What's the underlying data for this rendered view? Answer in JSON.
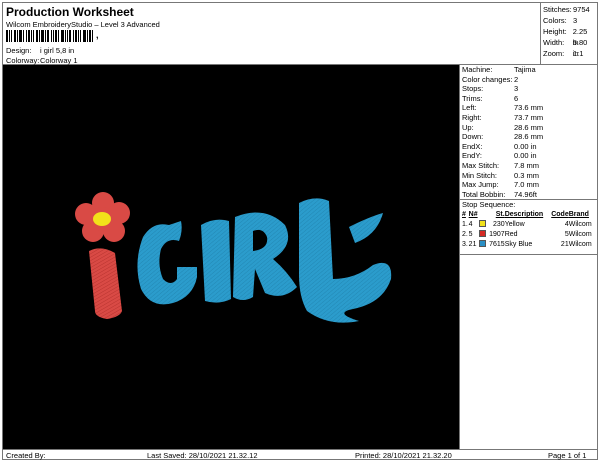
{
  "header": {
    "title": "Production Worksheet",
    "software": "Wilcom EmbroideryStudio – Level 3 Advanced",
    "barcode_suffix": ",",
    "design_label": "Design:",
    "design_value": "i girl 5,8 in",
    "colorway_label": "Colorway:",
    "colorway_value": "Colorway 1"
  },
  "summary": {
    "stitches_label": "Stitches:",
    "stitches_value": "9754",
    "colors_label": "Colors:",
    "colors_value": "3",
    "height_label": "Height:",
    "height_value": "2.25 in",
    "width_label": "Width:",
    "width_value": "5.80 in",
    "zoom_label": "Zoom:",
    "zoom_value": "1:1"
  },
  "stats": [
    {
      "label": "Machine:",
      "value": "Tajima"
    },
    {
      "label": "Color changes:",
      "value": "2"
    },
    {
      "label": "Stops:",
      "value": "3"
    },
    {
      "label": "Trims:",
      "value": "6"
    },
    {
      "label": "Left:",
      "value": "73.6 mm"
    },
    {
      "label": "Right:",
      "value": "73.7 mm"
    },
    {
      "label": "Up:",
      "value": "28.6 mm"
    },
    {
      "label": "Down:",
      "value": "28.6 mm"
    },
    {
      "label": "EndX:",
      "value": "0.00 in"
    },
    {
      "label": "EndY:",
      "value": "0.00 in"
    },
    {
      "label": "Max Stitch:",
      "value": "7.8 mm"
    },
    {
      "label": "Min Stitch:",
      "value": "0.3 mm"
    },
    {
      "label": "Max Jump:",
      "value": "7.0 mm"
    },
    {
      "label": "Total Bobbin:",
      "value": "74.96ft"
    }
  ],
  "stop_sequence": {
    "title": "Stop Sequence:",
    "headers": [
      "#",
      "N#",
      "St.",
      "Description",
      "Code",
      "Brand"
    ],
    "rows": [
      {
        "idx": "1.",
        "n": "4",
        "color": "#f2e21a",
        "st": "230",
        "desc": "Yellow",
        "code": "4",
        "brand": "Wilcom"
      },
      {
        "idx": "2.",
        "n": "5",
        "color": "#d42a24",
        "st": "1907",
        "desc": "Red",
        "code": "5",
        "brand": "Wilcom"
      },
      {
        "idx": "3.",
        "n": "21",
        "color": "#2a8fc4",
        "st": "7615",
        "desc": "Sky Blue",
        "code": "21",
        "brand": "Wilcom"
      }
    ]
  },
  "colors": {
    "canvas_bg": "#000000",
    "thread_yellow": "#f2e21a",
    "thread_red": "#d94a45",
    "thread_blue": "#2b9ccc"
  },
  "footer": {
    "created_by": "Created By:",
    "last_saved": "Last Saved: 28/10/2021 21.32.12",
    "printed": "Printed: 28/10/2021 21.32.20",
    "page": "Page 1 of 1"
  }
}
